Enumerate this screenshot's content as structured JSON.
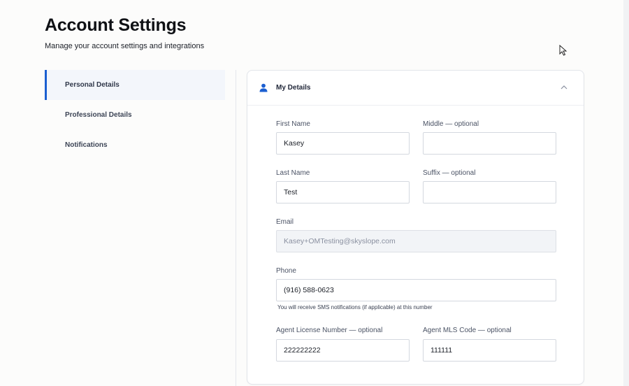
{
  "page": {
    "title": "Account Settings",
    "subtitle": "Manage your account settings and integrations"
  },
  "sidebar": {
    "items": [
      {
        "label": "Personal Details",
        "active": true
      },
      {
        "label": "Professional Details",
        "active": false
      },
      {
        "label": "Notifications",
        "active": false
      }
    ]
  },
  "card": {
    "title": "My Details",
    "icon": "user-icon",
    "collapse_icon": "chevron-up-icon"
  },
  "form": {
    "first_name": {
      "label": "First Name",
      "value": "Kasey"
    },
    "middle": {
      "label": "Middle — optional",
      "value": ""
    },
    "last_name": {
      "label": "Last Name",
      "value": "Test"
    },
    "suffix": {
      "label": "Suffix — optional",
      "value": ""
    },
    "email": {
      "label": "Email",
      "value": "Kasey+OMTesting@skyslope.com",
      "disabled": true
    },
    "phone": {
      "label": "Phone",
      "value": "(916) 588-0623",
      "helper": "You will receive SMS notifications (if applicable) at this number"
    },
    "license": {
      "label": "Agent License Number — optional",
      "value": "222222222"
    },
    "mls": {
      "label": "Agent MLS Code — optional",
      "value": "111111"
    }
  },
  "colors": {
    "accent": "#1b5fd1",
    "active_nav_bg": "#f3f6fb",
    "disabled_input_bg": "#f2f4f7"
  }
}
